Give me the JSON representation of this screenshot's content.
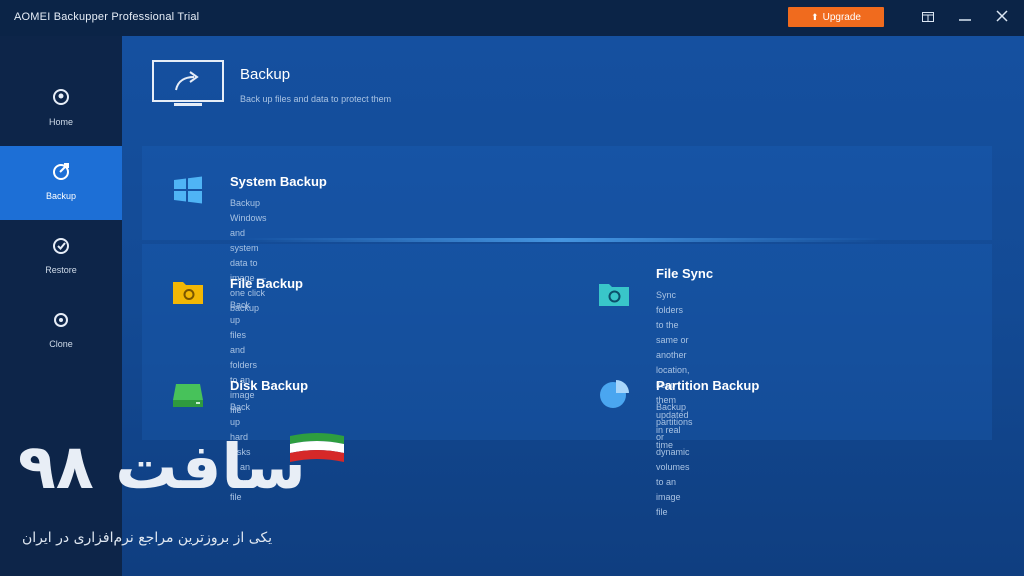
{
  "window": {
    "title": "AOMEI Backupper Professional Trial",
    "upgrade_label": "Upgrade",
    "controls": {
      "menu": "menu-icon",
      "minimize": "minimize-icon",
      "close": "close-icon"
    }
  },
  "sidebar": {
    "items": [
      {
        "label": "Home",
        "icon": "home-icon",
        "active": false
      },
      {
        "label": "Backup",
        "icon": "backup-icon",
        "active": true
      },
      {
        "label": "Restore",
        "icon": "restore-icon",
        "active": false
      },
      {
        "label": "Clone",
        "icon": "clone-icon",
        "active": false
      }
    ]
  },
  "main": {
    "header": {
      "title": "Backup",
      "subtitle": "Back up files and data to protect them",
      "icon": "monitor-backup-icon"
    },
    "cards": [
      {
        "id": "system",
        "title": "System Backup",
        "desc": "Backup Windows and system data to image — one click backup",
        "icon": "windows-icon"
      },
      {
        "id": "file",
        "title": "File Backup",
        "desc": "Back up files and folders to an image file",
        "icon": "folder-icon"
      },
      {
        "id": "sync",
        "title": "File Sync",
        "desc": "Sync folders to the same or another location, keep them updated",
        "desc2": "in real time",
        "icon": "file-sync-icon"
      },
      {
        "id": "disk",
        "title": "Disk Backup",
        "desc": "Back up hard disks to an image file",
        "icon": "disk-icon"
      },
      {
        "id": "partition",
        "title": "Partition Backup",
        "desc": "Backup partitions or dynamic volumes to an image file",
        "icon": "partition-icon"
      }
    ]
  },
  "watermark": {
    "logo_text": "سافت ۹۸",
    "slogan": "یکی از بروزترین مراجع نرم‌افزاری در ایران",
    "colors": {
      "green": "#2e9e3f",
      "white": "#ffffff",
      "red": "#d62828"
    }
  },
  "colors": {
    "accent": "#1d6fd6",
    "upgrade": "#f06b1e",
    "background": "#0f2a52"
  }
}
